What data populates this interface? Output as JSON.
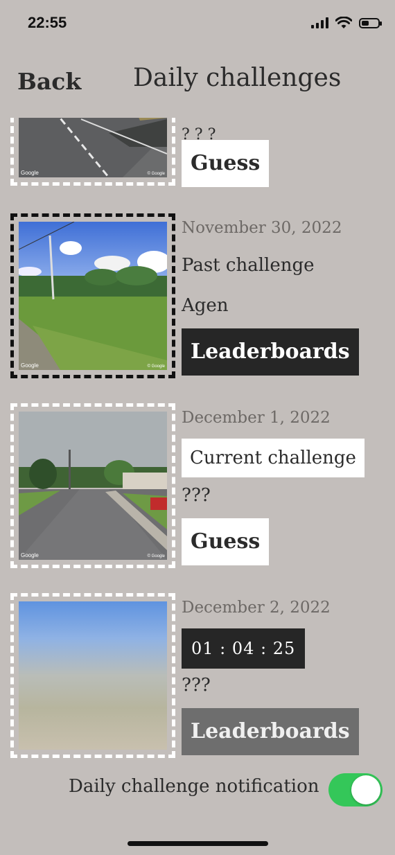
{
  "status_bar": {
    "time": "22:55",
    "icons": [
      "signal-icon",
      "wifi-icon",
      "battery-icon"
    ]
  },
  "header": {
    "back_label": "Back",
    "title": "Daily challenges"
  },
  "challenges": [
    {
      "date": "",
      "partial_text": "? ? ?",
      "button_label": "Guess",
      "watermark": "Google",
      "watermark_right": "© Google"
    },
    {
      "date": "November 30, 2022",
      "status": "Past challenge",
      "answer": "Agen",
      "button_label": "Leaderboards",
      "watermark": "Google",
      "watermark_right": "© Google"
    },
    {
      "date": "December 1, 2022",
      "status": "Current challenge",
      "answer": "???",
      "button_label": "Guess",
      "watermark": "Google",
      "watermark_right": "© Google"
    },
    {
      "date": "December 2, 2022",
      "countdown": "01 : 04 : 25",
      "answer": "???",
      "button_label": "Leaderboards"
    }
  ],
  "footer": {
    "notification_label": "Daily challenge notification",
    "notification_enabled": true
  },
  "colors": {
    "background": "#c3bebb",
    "toggle_on": "#34c759",
    "dark_button": "#262626",
    "gray_button": "#6e6e6e"
  }
}
